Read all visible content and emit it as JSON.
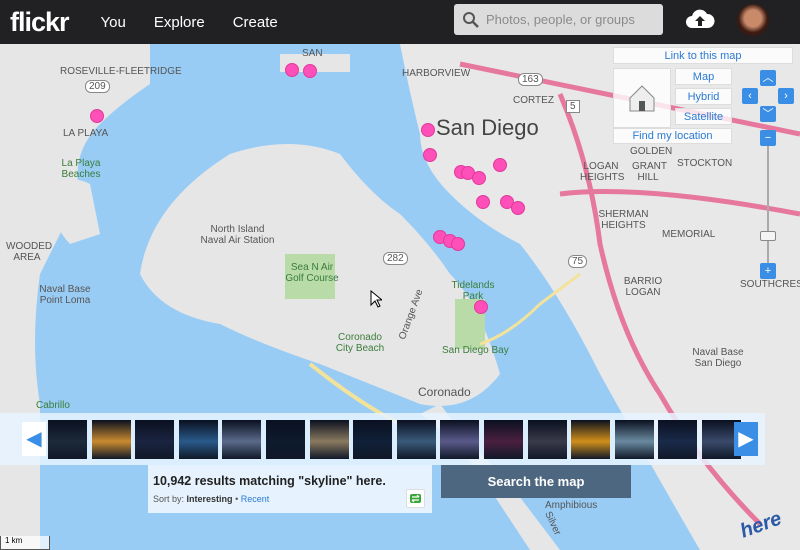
{
  "header": {
    "logo": "flickr",
    "nav": [
      "You",
      "Explore",
      "Create"
    ],
    "search_placeholder": "Photos, people, or groups",
    "icons": [
      "search-icon",
      "upload-cloud-icon",
      "avatar"
    ]
  },
  "map_controls": {
    "link": "Link to this map",
    "types": [
      "Map",
      "Hybrid",
      "Satellite"
    ],
    "find_location": "Find my location",
    "zoom_in": "+",
    "zoom_out": "−"
  },
  "map_labels": [
    "ROSEVILLE-FLEETRIDGE",
    "SAN",
    "HARBORVIEW",
    "CORTEZ",
    "San Diego",
    "LA PLAYA",
    "La Playa Beaches",
    "WOODED AREA",
    "Naval Base Point Loma",
    "North Island Naval Air Station",
    "Sea N Air Golf Course",
    "Coronado City Beach",
    "Orange Ave",
    "Tidelands Park",
    "San Diego Bay",
    "Coronado",
    "Cabrillo",
    "LOGAN HEIGHTS",
    "GRANT HILL",
    "STOCKTON",
    "SHERMAN HEIGHTS",
    "MEMORIAL",
    "BARRIO LOGAN",
    "SOUTHCREST",
    "Naval Base San Diego",
    "Amphibious",
    "Silver",
    "GOLDEN"
  ],
  "road_shields": [
    "209",
    "163",
    "5",
    "282",
    "75"
  ],
  "scale": "1 km",
  "attribution": "here",
  "thumbnails": 16,
  "thumb_colors": [
    "#1c2a3a",
    "#c98a30",
    "#1a2440",
    "#2a5a8a",
    "#5a6a8a",
    "#0e1a2e",
    "#8a7a60",
    "#102038",
    "#3a5a7a",
    "#5a5a8a",
    "#4a2040",
    "#3a3a4a",
    "#d0901a",
    "#6a8aa0",
    "#1a2a4a",
    "#3a4a6a"
  ],
  "results": {
    "text": "10,942 results matching \"skyline\" here.",
    "sort_label": "Sort by:",
    "sort_active": "Interesting",
    "separator": "•",
    "sort_other": "Recent"
  },
  "search_map_button": "Search the map",
  "colors": {
    "marker": "#ff4fb8",
    "water": "#99ccf5",
    "header": "#212124",
    "accent": "#3a8ee6"
  }
}
